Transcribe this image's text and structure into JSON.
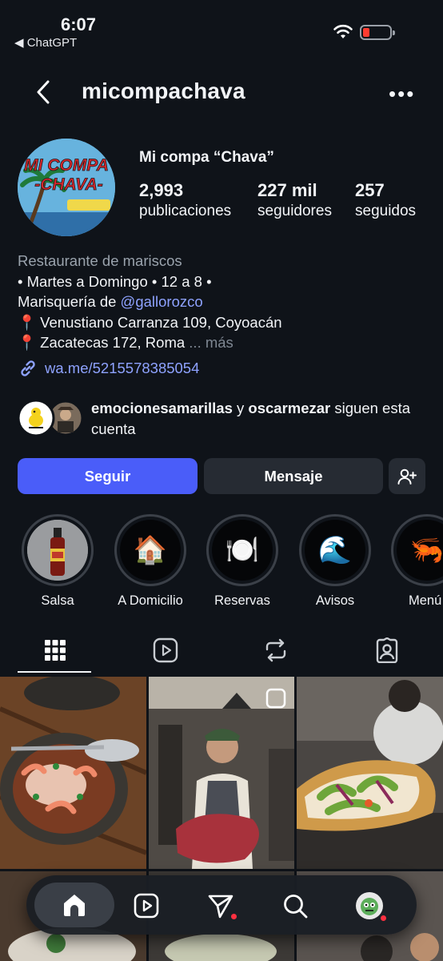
{
  "status_bar": {
    "time": "6:07",
    "back_app": "◀ ChatGPT"
  },
  "header": {
    "username": "micompachava",
    "more_glyph": "•••"
  },
  "profile": {
    "display_name": "Mi compa “Chava”",
    "avatar_text_line1": "MI COMPA",
    "avatar_text_line2": "-CHAVA-",
    "stats": [
      {
        "value": "2,993",
        "label": "publicaciones"
      },
      {
        "value": "227 mil",
        "label": "seguidores"
      },
      {
        "value": "257",
        "label": "seguidos"
      }
    ]
  },
  "bio": {
    "category": "Restaurante de mariscos",
    "line1": "• Martes a Domingo • 12 a 8 •",
    "line2_prefix": "Marisquería de ",
    "line2_mention": "@gallorozco",
    "line3": "📍 Venustiano Carranza 109, Coyoacán",
    "line4": "📍 Zacatecas 172, Roma",
    "more": "... más",
    "link": "wa.me/5215578385054"
  },
  "mutual": {
    "user1": "emocionesamarillas",
    "connector": " y ",
    "user2": "oscarmezar",
    "suffix": " siguen esta cuenta"
  },
  "actions": {
    "follow": "Seguir",
    "message": "Mensaje"
  },
  "highlights": [
    {
      "label": "Salsa",
      "emoji": "🌶️"
    },
    {
      "label": "A Domicilio",
      "emoji": "🏠"
    },
    {
      "label": "Reservas",
      "emoji": "🍽️"
    },
    {
      "label": "Avisos",
      "emoji": "🌊"
    },
    {
      "label": "Menú",
      "emoji": "🦐"
    }
  ],
  "colors": {
    "follow_button": "#4a5df9",
    "link": "#8ea2ff",
    "background": "#0f1319",
    "notification_dot": "#ff3040"
  }
}
